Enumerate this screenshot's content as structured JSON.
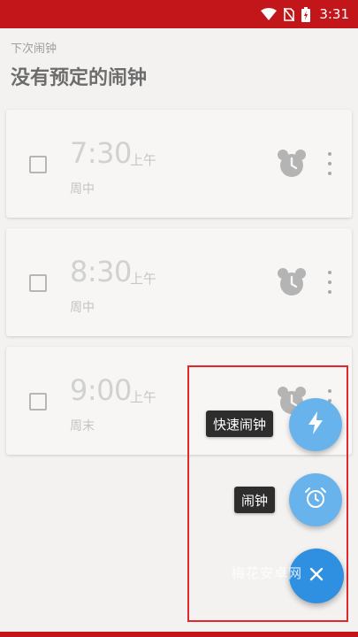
{
  "status_bar": {
    "time": "3:31",
    "icons": [
      "wifi-icon",
      "no-sim-icon",
      "battery-icon"
    ],
    "background": "#c2161b"
  },
  "header": {
    "next_alarm_label": "下次闹钟",
    "next_alarm_value": "没有预定的闹钟"
  },
  "alarms": [
    {
      "time": "7:30",
      "ampm": "上午",
      "days": "周中",
      "enabled": false
    },
    {
      "time": "8:30",
      "ampm": "上午",
      "days": "周中",
      "enabled": false
    },
    {
      "time": "9:00",
      "ampm": "上午",
      "days": "周末",
      "enabled": false
    }
  ],
  "fab_menu": {
    "quick_alarm_label": "快速闹钟",
    "alarm_label": "闹钟",
    "mini_color": "#69b3ec",
    "main_color": "#2f8fe0"
  },
  "watermark": "梅花安卓网"
}
